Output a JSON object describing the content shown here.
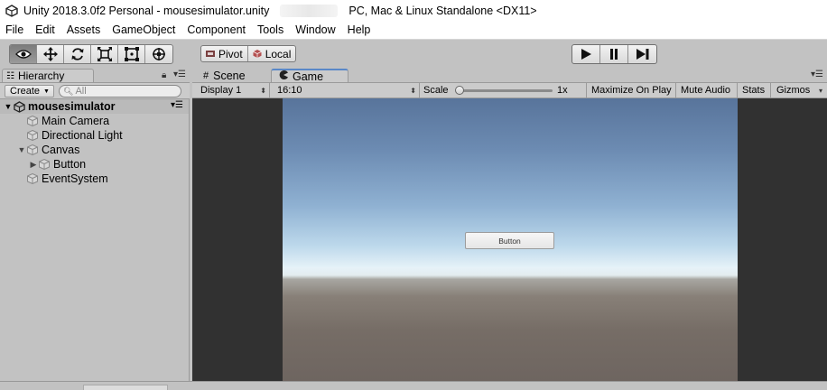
{
  "window": {
    "title": "Unity 2018.3.0f2 Personal - mousesimulator.unity",
    "platform": "PC, Mac & Linux Standalone <DX11>"
  },
  "menubar": [
    "File",
    "Edit",
    "Assets",
    "GameObject",
    "Component",
    "Tools",
    "Window",
    "Help"
  ],
  "toolbar": {
    "tools": [
      "view-tool",
      "move-tool",
      "rotate-tool",
      "scale-tool",
      "rect-tool",
      "transform-tool"
    ],
    "active_tool": "view-tool",
    "pivot_label": "Pivot",
    "local_label": "Local",
    "play_controls": [
      "play",
      "pause",
      "step"
    ]
  },
  "hierarchy": {
    "tab_label": "Hierarchy",
    "create_label": "Create",
    "search_placeholder": "All",
    "scene_name": "mousesimulator",
    "items": [
      {
        "label": "Main Camera",
        "depth": 1,
        "expander": ""
      },
      {
        "label": "Directional Light",
        "depth": 1,
        "expander": ""
      },
      {
        "label": "Canvas",
        "depth": 1,
        "expander": "expanded"
      },
      {
        "label": "Button",
        "depth": 2,
        "expander": "collapsed"
      },
      {
        "label": "EventSystem",
        "depth": 1,
        "expander": ""
      }
    ]
  },
  "tabs": {
    "scene_label": "Scene",
    "game_label": "Game",
    "active": "Game"
  },
  "game_toolbar": {
    "display": "Display 1",
    "aspect": "16:10",
    "scale_label": "Scale",
    "scale_value": "1x",
    "maximize_label": "Maximize On Play",
    "mute_label": "Mute Audio",
    "stats_label": "Stats",
    "gizmos_label": "Gizmos"
  },
  "game_view": {
    "button_text": "Button"
  },
  "colors": {
    "panel_bg": "#c2c2c2",
    "active_tab_accent": "#5a88c8",
    "game_bg": "#313131"
  }
}
